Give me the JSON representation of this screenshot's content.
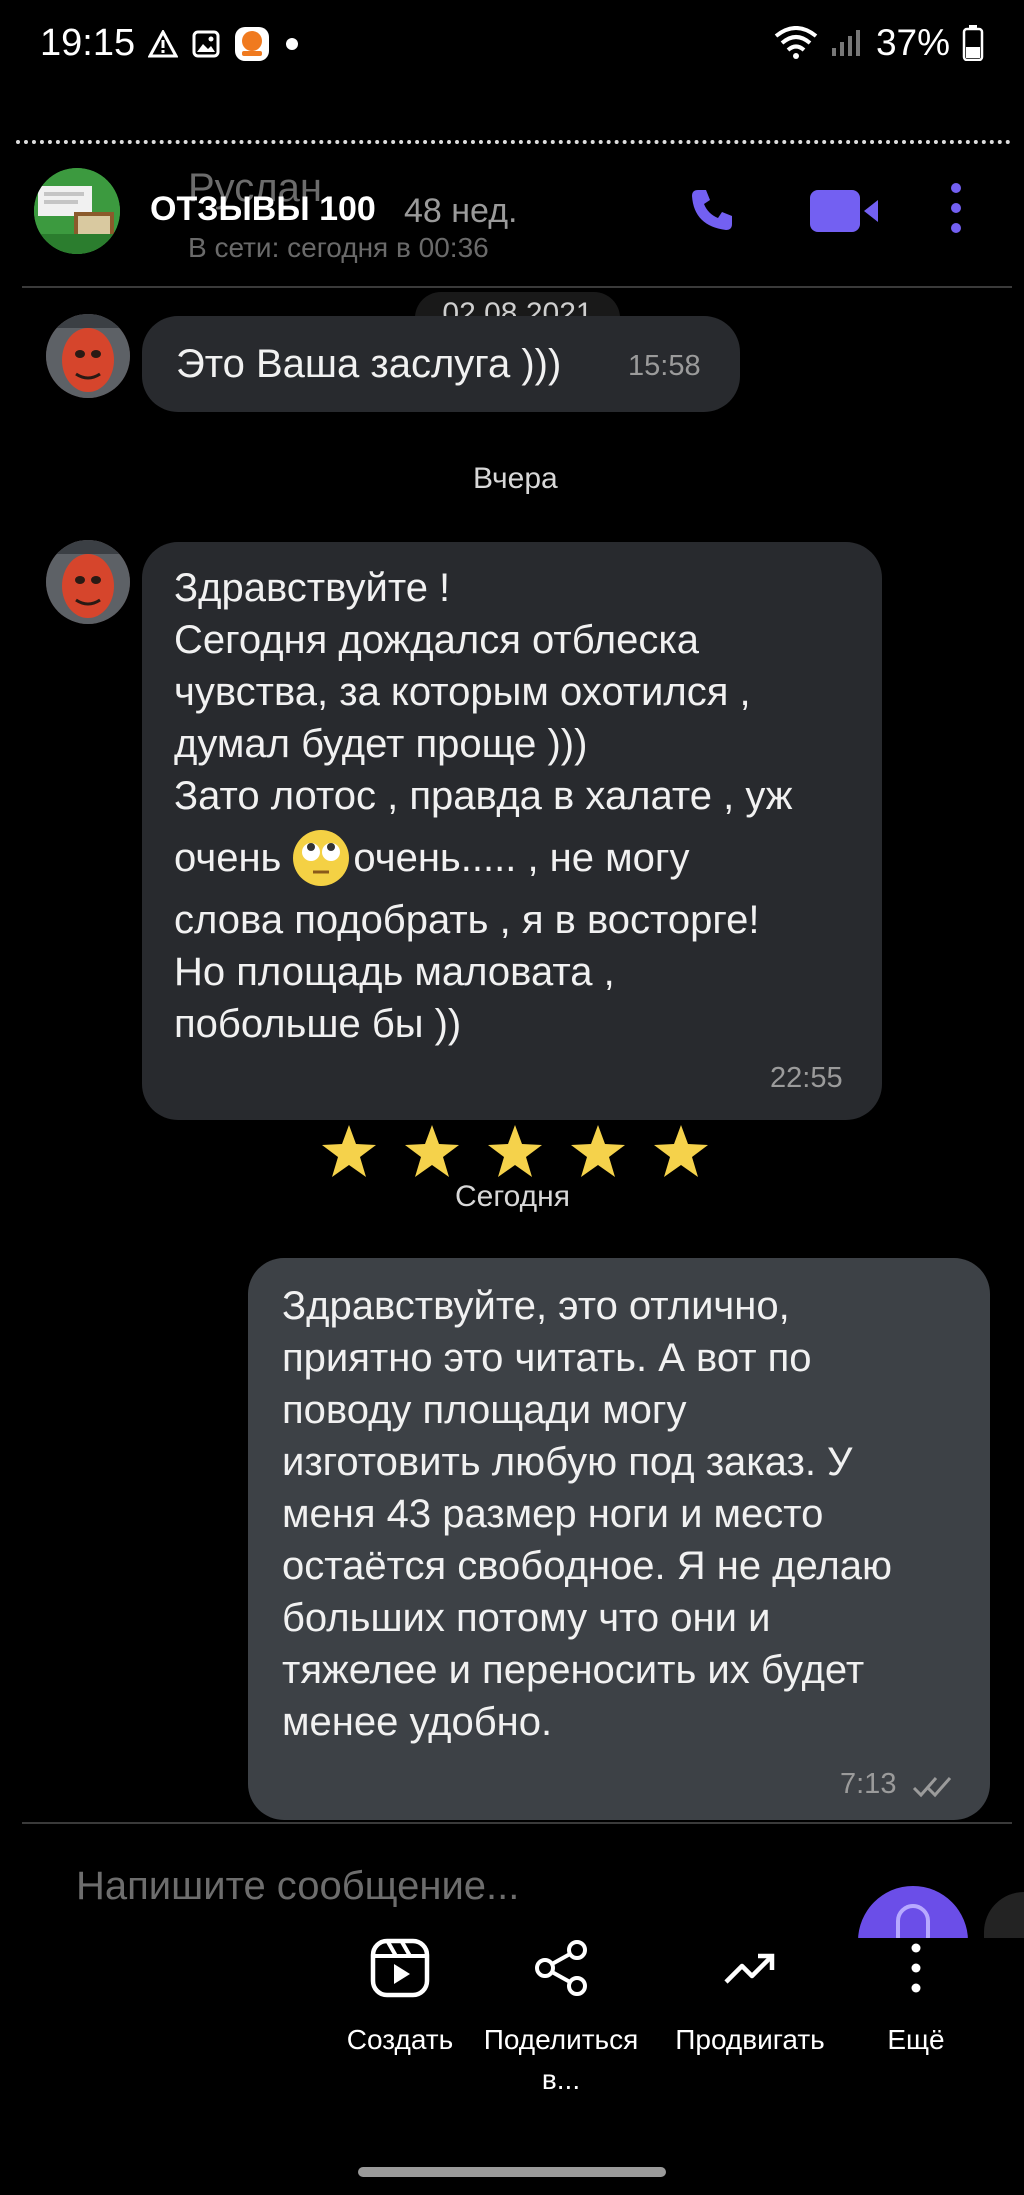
{
  "status_bar": {
    "time": "19:15",
    "battery": "37%",
    "icons": [
      "warning-icon",
      "image-icon",
      "app-notification-icon",
      "dot-icon",
      "wifi-icon",
      "signal-icon",
      "battery-icon"
    ]
  },
  "header": {
    "contact_name_ghost": "Руслан",
    "title_overlay": "ОТЗЫВЫ 100",
    "weeks": "48 нед.",
    "status": "В сети: сегодня в 00:36",
    "accent": "#7360f2"
  },
  "chat": {
    "date_chip": "02.08.2021",
    "messages": [
      {
        "direction": "in",
        "text": "Это Ваша заслуга )))",
        "time": "15:58"
      },
      {
        "direction": "in",
        "lines": [
          "Здравствуйте !",
          "Сегодня дождался отблеска",
          "чувства, за которым охотился ,",
          "думал будет проще )))",
          "Зато лотос , правда в халате , уж",
          "очень",
          "очень..... , не могу",
          "слова подобрать , я в восторге!",
          "Но площадь маловата ,",
          "побольше бы ))"
        ],
        "time": "22:55"
      },
      {
        "direction": "out",
        "text": "Здравствуйте, это отлично,\nприятно это читать. А вот по\nповоду площади могу\nизготовить любую под заказ. У\nменя 43 размер ноги и место\nостаётся свободное. Я не делаю\nбольших потому что они и\nтяжелее и переносить их будет\nменее удобно.",
        "time": "7:13"
      }
    ],
    "day_labels": {
      "yesterday": "Вчера",
      "today": "Сегодня"
    },
    "rating_stars": 5,
    "star_color": "#f5d24b"
  },
  "composer": {
    "placeholder": "Напишите сообщение..."
  },
  "actions": [
    {
      "label": "Создать",
      "icon": "reels-icon"
    },
    {
      "label": "Поделиться\nв...",
      "icon": "share-icon"
    },
    {
      "label": "Продвигать",
      "icon": "trending-up-icon"
    },
    {
      "label": "Ещё",
      "icon": "more-vertical-icon"
    }
  ]
}
